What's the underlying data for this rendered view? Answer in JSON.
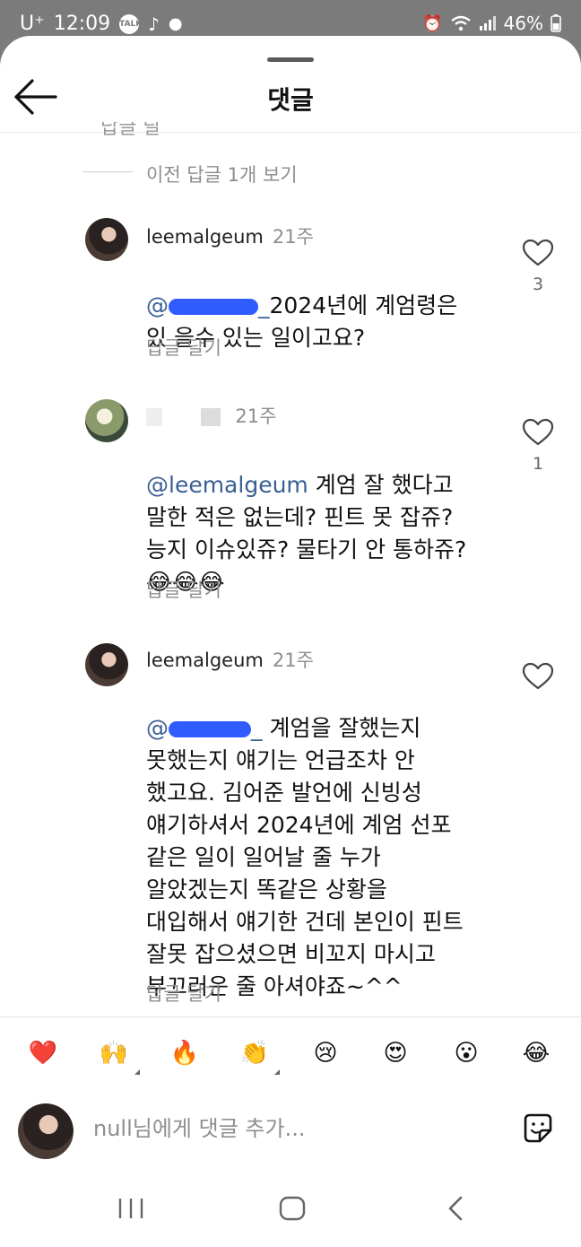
{
  "status_bar": {
    "carrier": "U⁺",
    "time": "12:09",
    "battery": "46%"
  },
  "header": {
    "title": "댓글"
  },
  "clipped_text": "답글 달",
  "prev_replies": "이전 답글 1개 보기",
  "comments": [
    {
      "username": "leemalgeum",
      "time": "21주",
      "mention_suffix": "_",
      "text": "2024년에 계엄령은\n있 을수 있는 일이고요?",
      "reply": "답글 달기",
      "likes": "3"
    },
    {
      "username": "",
      "time": "21주",
      "mention": "@leemalgeum",
      "text": " 계엄 잘 했다고\n말한 적은 없는데? 핀트 못 잡쥬?\n능지 이슈있쥬? 물타기 안 통하쥬?\n😂😂😂",
      "reply": "답글 달기",
      "likes": "1"
    },
    {
      "username": "leemalgeum",
      "time": "21주",
      "mention_suffix": "_",
      "text": "  계엄을 잘했는지\n못했는지 얘기는 언급조차 안\n했고요. 김어준 발언에 신빙성\n얘기하셔서 2024년에 계엄 선포\n같은 일이 일어날 줄 누가\n알았겠는지 똑같은 상황을\n대입해서 얘기한 건데 본인이 핀트\n잘못 잡으셨으면 비꼬지 마시고\n부끄러운 줄 아셔야죠~^^",
      "reply": "답글 달기",
      "likes": ""
    }
  ],
  "emoji_bar": [
    "❤️",
    "🙌",
    "🔥",
    "👏",
    "😢",
    "😍",
    "😮",
    "😂"
  ],
  "input": {
    "placeholder": "null님에게 댓글 추가..."
  }
}
